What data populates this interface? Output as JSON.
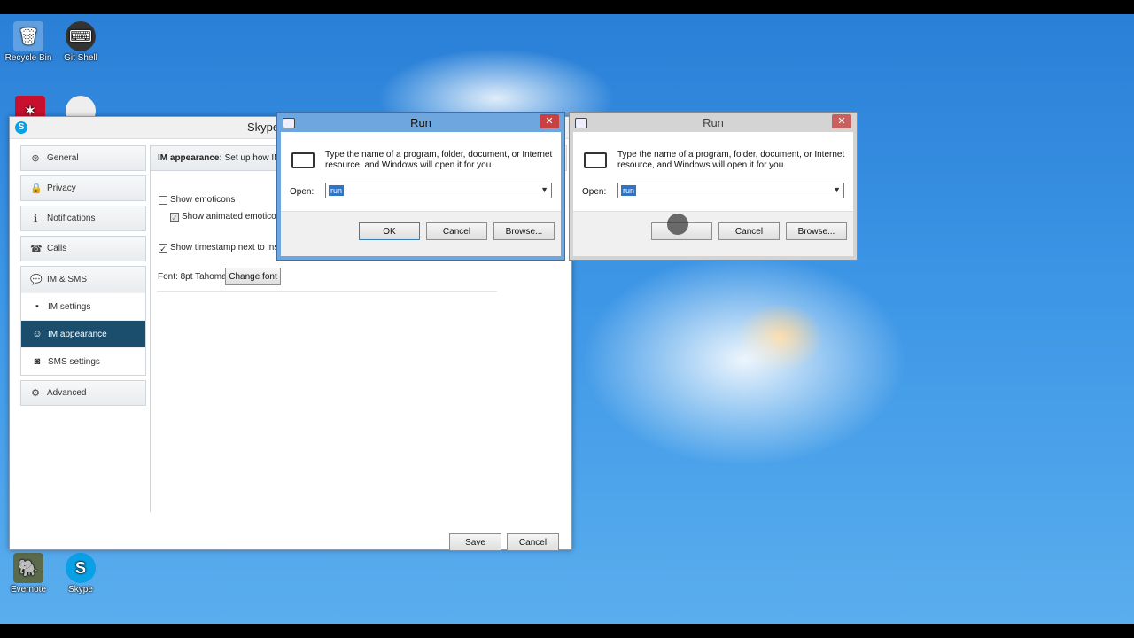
{
  "desktop": {
    "icons": [
      {
        "label": "Recycle Bin",
        "glyph": "🗑"
      },
      {
        "label": "Git Shell",
        "glyph": "⌨"
      },
      {
        "label": "Evernote",
        "glyph": "🐘"
      },
      {
        "label": "Skype",
        "glyph": "S"
      }
    ]
  },
  "skype": {
    "title": "Skype",
    "icon_letter": "S",
    "nav": {
      "general": "General",
      "privacy": "Privacy",
      "notifications": "Notifications",
      "calls": "Calls",
      "im_sms": "IM & SMS",
      "im_settings": "IM settings",
      "im_appearance": "IM appearance",
      "sms_settings": "SMS settings",
      "advanced": "Advanced"
    },
    "content": {
      "header_bold": "IM appearance:",
      "header_rest": " Set up how IM lo",
      "show_emoticons": "Show emoticons",
      "show_animated": "Show animated emoticons",
      "show_timestamp": "Show timestamp next to instant",
      "font_label": "Font: 8pt Tahoma",
      "change_font": "Change font"
    },
    "save": "Save",
    "cancel": "Cancel"
  },
  "run_dialog": {
    "title": "Run",
    "close": "✕",
    "description": "Type the name of a program, folder, document, or Internet resource, and Windows will open it for you.",
    "open_label": "Open:",
    "open_value": "run",
    "ok": "OK",
    "cancel": "Cancel",
    "browse": "Browse..."
  },
  "colors": {
    "skype_active_nav": "#1b4e6d",
    "run_active_frame": "#6ea7e0",
    "run_inactive_frame": "#d4d4d4",
    "selection": "#3373c4"
  }
}
